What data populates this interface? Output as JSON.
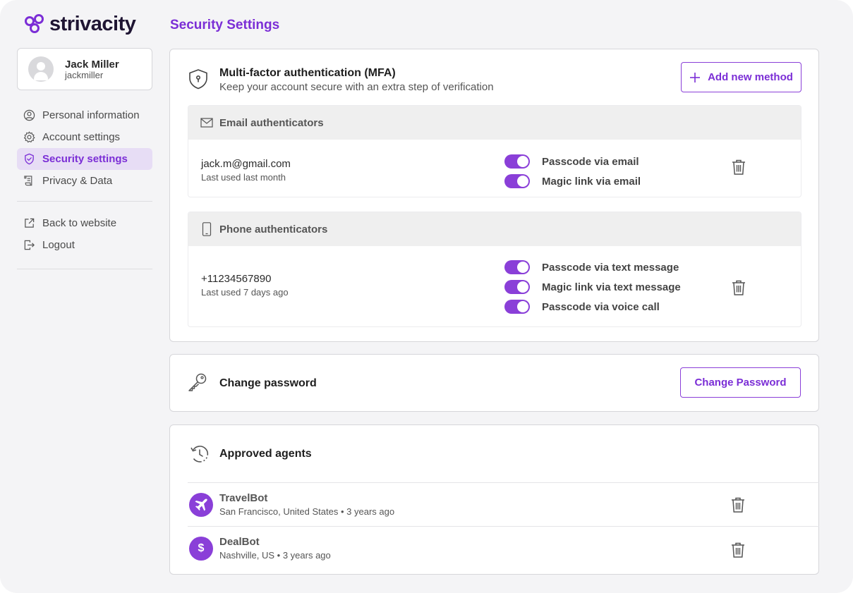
{
  "brand": {
    "name": "strivacity",
    "accent": "#8a3fd8"
  },
  "user": {
    "name": "Jack Miller",
    "handle": "jackmiller"
  },
  "sidebar": {
    "items": [
      {
        "label": "Personal information",
        "icon": "user-circle-icon"
      },
      {
        "label": "Account settings",
        "icon": "gear-icon"
      },
      {
        "label": "Security settings",
        "icon": "shield-icon",
        "active": true
      },
      {
        "label": "Privacy & Data",
        "icon": "document-icon"
      }
    ],
    "secondary": [
      {
        "label": "Back to website",
        "icon": "external-link-icon"
      },
      {
        "label": "Logout",
        "icon": "logout-icon"
      }
    ]
  },
  "page": {
    "title": "Security Settings"
  },
  "mfa": {
    "title": "Multi-factor authentication (MFA)",
    "subtitle": "Keep your account secure with an extra step of verification",
    "add_button": "Add new method",
    "email": {
      "heading": "Email authenticators",
      "value": "jack.m@gmail.com",
      "meta": "Last used last month",
      "methods": [
        {
          "label": "Passcode via email",
          "enabled": true
        },
        {
          "label": "Magic link via email",
          "enabled": true
        }
      ]
    },
    "phone": {
      "heading": "Phone authenticators",
      "value": "+11234567890",
      "meta": "Last used 7 days ago",
      "methods": [
        {
          "label": "Passcode via text message",
          "enabled": true
        },
        {
          "label": "Magic link via text message",
          "enabled": true
        },
        {
          "label": "Passcode via voice call",
          "enabled": true
        }
      ]
    }
  },
  "password": {
    "title": "Change password",
    "button": "Change Password"
  },
  "agents": {
    "title": "Approved agents",
    "items": [
      {
        "name": "TravelBot",
        "location": "San Francisco, United States",
        "age": "3 years ago",
        "icon": "airplane-icon"
      },
      {
        "name": "DealBot",
        "location": "Nashville, US",
        "age": "3 years ago",
        "icon": "dollar-icon",
        "glyph": "$"
      }
    ]
  }
}
